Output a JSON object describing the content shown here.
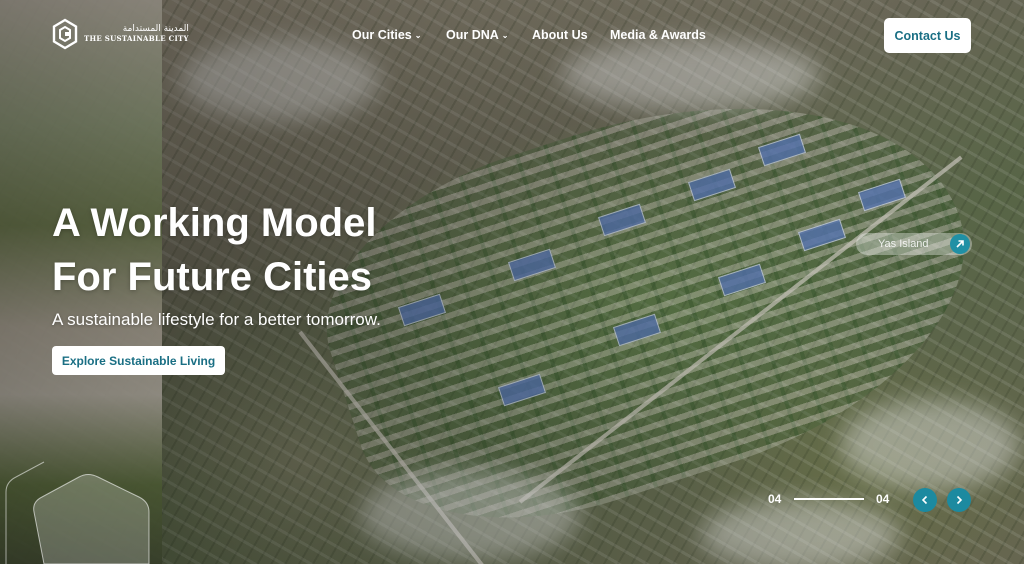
{
  "header": {
    "logo_arabic": "المدينة المستدامة",
    "logo_english": "THE SUSTAINABLE CITY",
    "nav": [
      {
        "label": "Our Cities",
        "has_dropdown": true
      },
      {
        "label": "Our DNA",
        "has_dropdown": true
      },
      {
        "label": "About Us",
        "has_dropdown": false
      },
      {
        "label": "Media & Awards",
        "has_dropdown": false
      }
    ],
    "contact_label": "Contact Us"
  },
  "hero": {
    "title_line1": "A Working Model",
    "title_line2": "For Future Cities",
    "subtitle": "A sustainable lifestyle for a better tomorrow.",
    "cta_label": "Explore Sustainable Living",
    "location_label": "Yas Island"
  },
  "slider": {
    "current": "04",
    "total": "04"
  },
  "colors": {
    "accent": "#1c8aa0",
    "button_text": "#1a6f84"
  }
}
